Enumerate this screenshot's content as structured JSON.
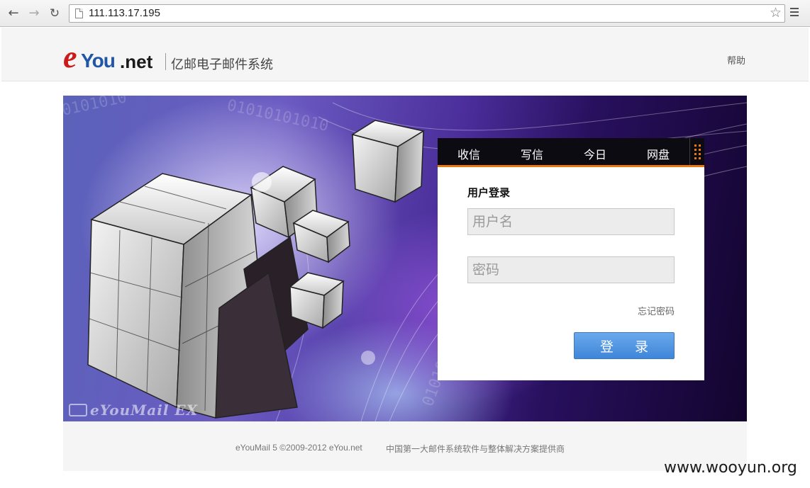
{
  "browser": {
    "url": "111.113.17.195"
  },
  "header": {
    "logo": {
      "e": "e",
      "you": "You",
      "net": ".net"
    },
    "system_name": "亿邮电子邮件系统",
    "help": "帮助"
  },
  "banner": {
    "watermark": "eYouMail EX"
  },
  "login": {
    "tabs": [
      "收信",
      "写信",
      "今日",
      "网盘"
    ],
    "title": "用户登录",
    "username_placeholder": "用户名",
    "password_placeholder": "密码",
    "forgot": "忘记密码",
    "submit": "登 录"
  },
  "footer": {
    "copyright": "eYouMail 5 ©2009-2012 eYou.net",
    "slogan": "中国第一大邮件系统软件与整体解决方案提供商"
  },
  "page_watermark": "www.wooyun.org",
  "colors": {
    "accent_orange": "#e8780f",
    "button_blue": "#4a8fdc",
    "logo_red": "#cc1a1a",
    "logo_blue": "#1f56a8"
  }
}
